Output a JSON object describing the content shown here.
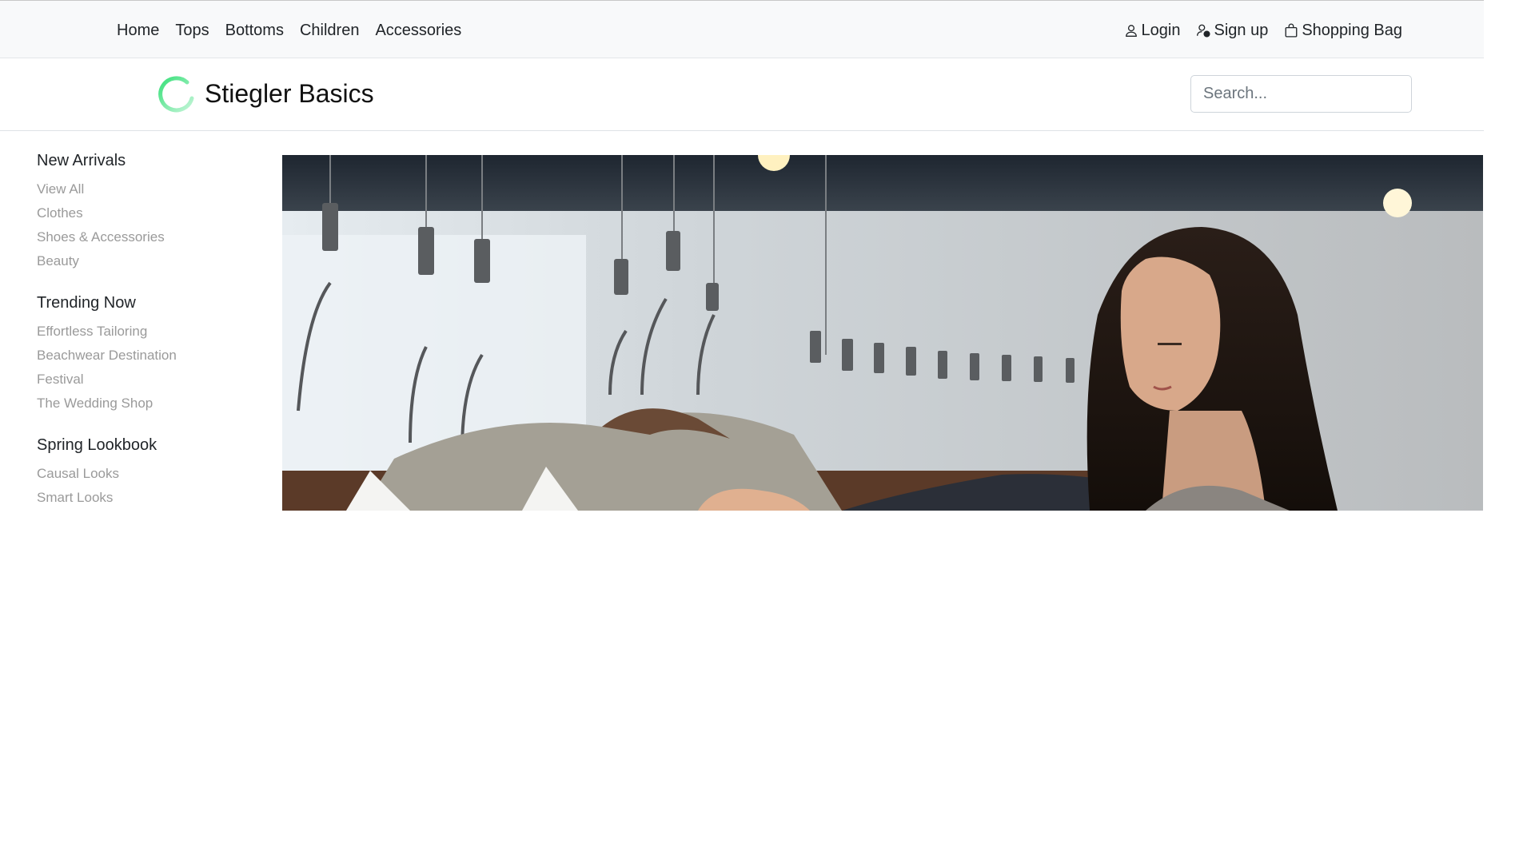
{
  "topnav": {
    "links": [
      "Home",
      "Tops",
      "Bottoms",
      "Children",
      "Accessories"
    ]
  },
  "usernav": {
    "login": "Login",
    "signup": "Sign up",
    "bag": "Shopping Bag",
    "icons": [
      "person-icon",
      "person-add-icon",
      "shopping-bag-icon"
    ]
  },
  "brand": {
    "name": "Stiegler Basics",
    "logo_colors": [
      "#39e07a",
      "#a8f0c4"
    ]
  },
  "search": {
    "placeholder": "Search..."
  },
  "sidebar": {
    "sections": [
      {
        "title": "New Arrivals",
        "items": [
          "View All",
          "Clothes",
          "Shoes & Accessories",
          "Beauty"
        ]
      },
      {
        "title": "Trending Now",
        "items": [
          "Effortless Tailoring",
          "Beachwear Destination",
          "Festival",
          "The Wedding Shop"
        ]
      },
      {
        "title": "Spring Lookbook",
        "items": [
          "Causal Looks",
          "Smart Looks"
        ]
      }
    ]
  }
}
